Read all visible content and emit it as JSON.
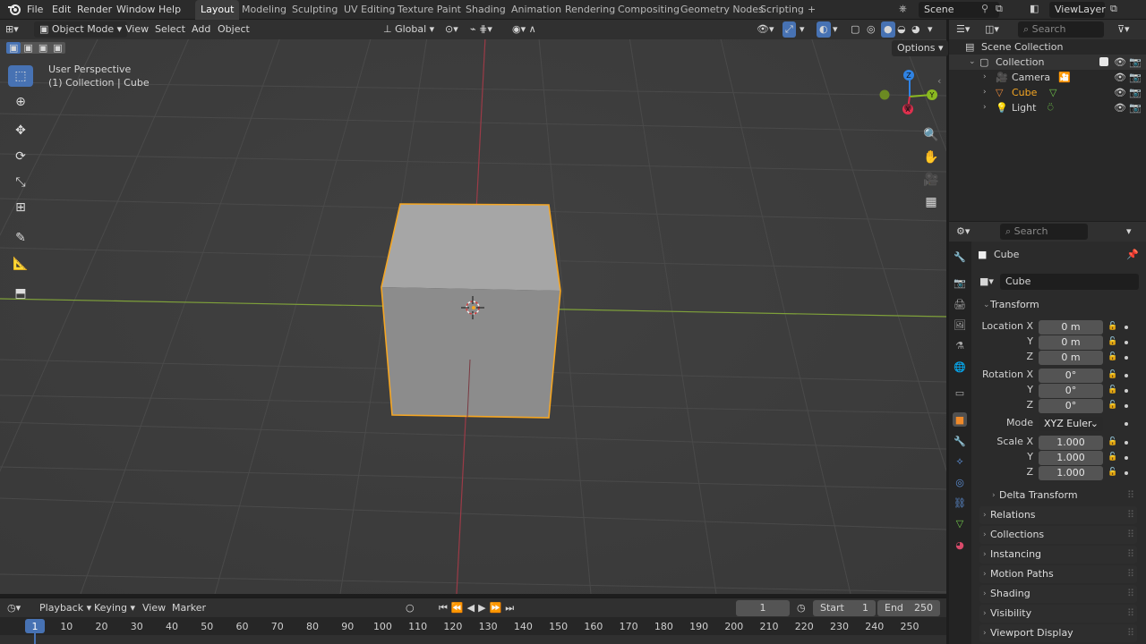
{
  "topbar": {
    "menus": [
      "File",
      "Edit",
      "Render",
      "Window",
      "Help"
    ],
    "workspaces": [
      "Layout",
      "Modeling",
      "Sculpting",
      "UV Editing",
      "Texture Paint",
      "Shading",
      "Animation",
      "Rendering",
      "Compositing",
      "Geometry Nodes",
      "Scripting"
    ],
    "active_workspace": "Layout",
    "add_tab": "+",
    "scene": "Scene",
    "view_layer": "ViewLayer"
  },
  "viewport_header": {
    "mode": "Object Mode",
    "menus": [
      "View",
      "Select",
      "Add",
      "Object"
    ],
    "transform_orientation": "Global",
    "options": "Options"
  },
  "viewport": {
    "perspective_label": "User Perspective",
    "collection_label": "(1) Collection | Cube",
    "gizmo_axes": {
      "x": "X",
      "y": "Y",
      "z": "Z"
    },
    "accent_selected": "#f5a623",
    "axis_red": "#e0304e",
    "axis_green": "#8ab920",
    "axis_blue": "#2f83e4"
  },
  "timeline": {
    "menus": [
      "Playback",
      "Keying",
      "View",
      "Marker"
    ],
    "current_frame": "1",
    "start_label": "Start",
    "start": "1",
    "end_label": "End",
    "end": "250",
    "ruler": [
      "1",
      "10",
      "20",
      "30",
      "40",
      "50",
      "60",
      "70",
      "80",
      "90",
      "100",
      "110",
      "120",
      "130",
      "140",
      "150",
      "160",
      "170",
      "180",
      "190",
      "200",
      "210",
      "220",
      "230",
      "240",
      "250"
    ]
  },
  "outliner": {
    "search_placeholder": "Search",
    "scene_collection": "Scene Collection",
    "collection": "Collection",
    "items": [
      "Camera",
      "Cube",
      "Light"
    ]
  },
  "properties": {
    "search_placeholder": "Search",
    "object_name": "Cube",
    "datablock_name": "Cube",
    "transform_label": "Transform",
    "location_label": "Location X",
    "rotation_label": "Rotation X",
    "scale_label": "Scale X",
    "axis_y": "Y",
    "axis_z": "Z",
    "location": [
      "0 m",
      "0 m",
      "0 m"
    ],
    "rotation": [
      "0°",
      "0°",
      "0°"
    ],
    "mode_label": "Mode",
    "mode_value": "XYZ Euler",
    "scale": [
      "1.000",
      "1.000",
      "1.000"
    ],
    "delta_transform": "Delta Transform",
    "panels": [
      "Relations",
      "Collections",
      "Instancing",
      "Motion Paths",
      "Shading",
      "Visibility",
      "Viewport Display"
    ]
  }
}
